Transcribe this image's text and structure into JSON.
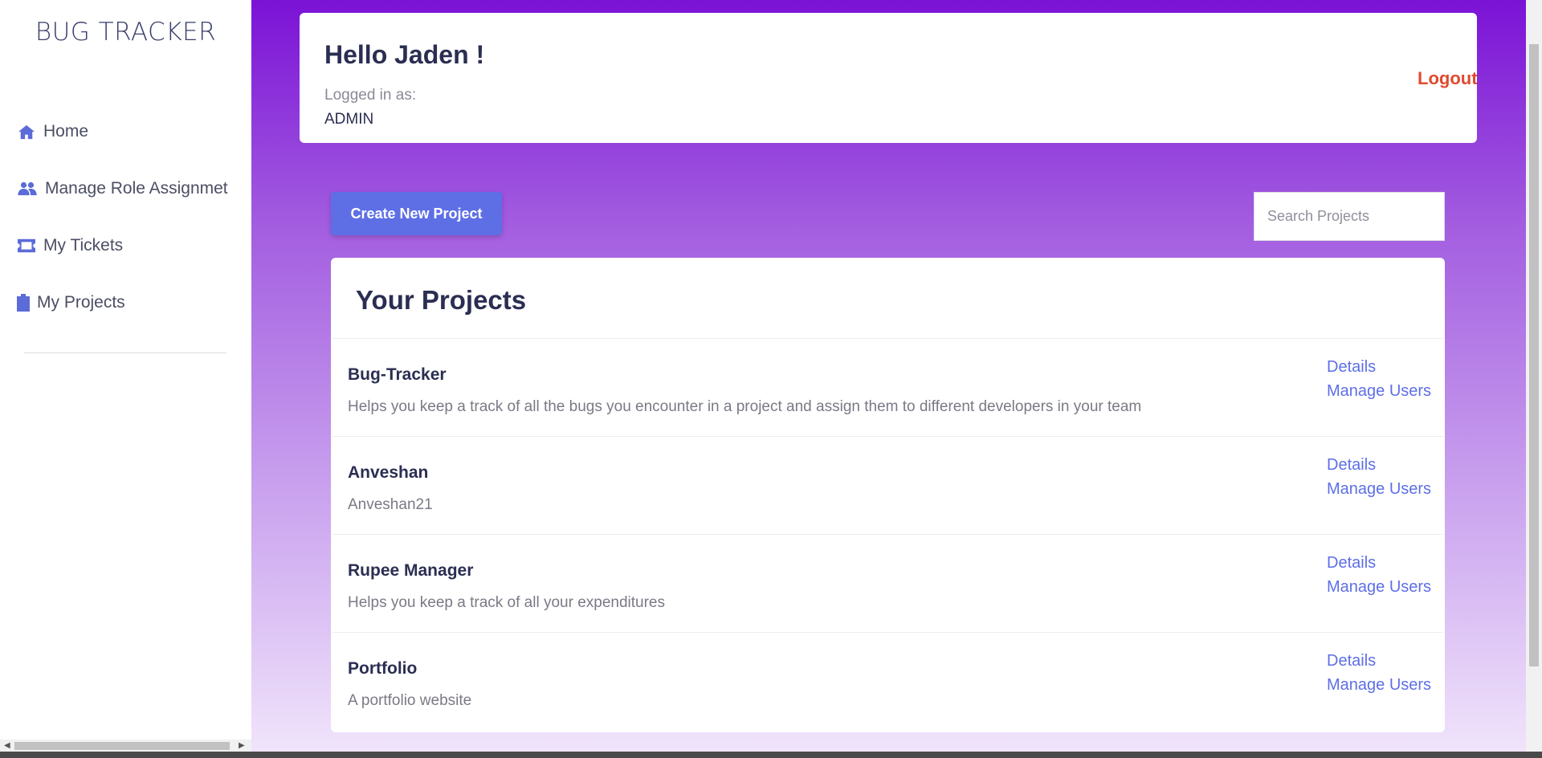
{
  "sidebar": {
    "brand": "BUG TRACKER",
    "items": [
      {
        "label": "Home",
        "icon": "home-icon"
      },
      {
        "label": "Manage Role Assignmet",
        "icon": "users-icon"
      },
      {
        "label": "My Tickets",
        "icon": "ticket-icon"
      },
      {
        "label": "My Projects",
        "icon": "clipboard-icon"
      }
    ]
  },
  "header": {
    "greeting": "Hello Jaden !",
    "logged_in_label": "Logged in as:",
    "role": "ADMIN",
    "logout_label": "Logout"
  },
  "toolbar": {
    "create_label": "Create New Project",
    "search_placeholder": "Search Projects"
  },
  "projects": {
    "title": "Your Projects",
    "details_label": "Details",
    "manage_label": "Manage Users",
    "items": [
      {
        "name": "Bug-Tracker",
        "description": "Helps you keep a track of all the bugs you encounter in a project and assign them to different developers in your team"
      },
      {
        "name": "Anveshan",
        "description": "Anveshan21"
      },
      {
        "name": "Rupee Manager",
        "description": "Helps you keep a track of all your expenditures"
      },
      {
        "name": "Portfolio",
        "description": "A portfolio website"
      }
    ]
  },
  "colors": {
    "accent": "#5e6fe6",
    "logout": "#e04a2f",
    "gradient_top": "#7b12d6",
    "gradient_bottom": "#f0e4fb"
  }
}
